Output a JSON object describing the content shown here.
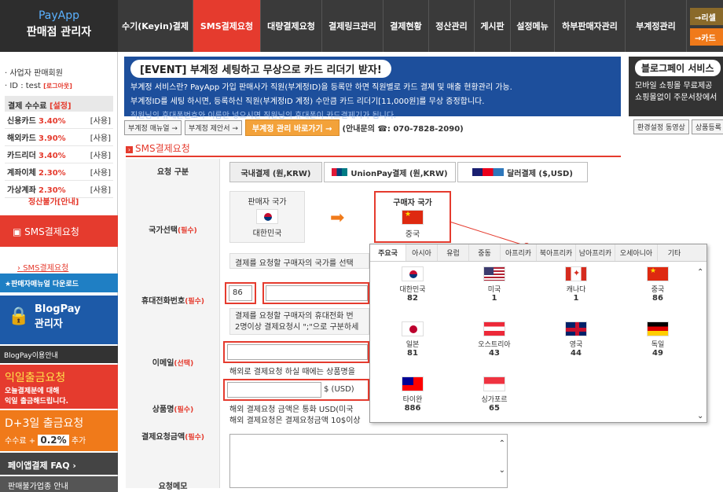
{
  "logo": {
    "brand": "PayApp",
    "subtitle": "판매점 관리자"
  },
  "nav": [
    "수기(Keyin)결제",
    "SMS결제요청",
    "대량결제요청",
    "결제링크관리",
    "결제현황",
    "정산관리",
    "게시판",
    "설정메뉴",
    "하부판매자관리",
    "부계정관리"
  ],
  "top_buttons": [
    "→리셀",
    "→카드"
  ],
  "sidebar": {
    "seller": "사업자 판매회원",
    "id_label": "ID",
    "id_value": ": test",
    "logout": "[로그아웃]",
    "fee_label": "결제 수수료",
    "fee_setting": "[설정]",
    "fees": [
      {
        "name": "신용카드",
        "rate": "3.40%",
        "tag": "[사용]"
      },
      {
        "name": "해외카드",
        "rate": "3.90%",
        "tag": "[사용]"
      },
      {
        "name": "카드리더",
        "rate": "3.40%",
        "tag": "[사용]"
      },
      {
        "name": "계좌이체",
        "rate": "2.30%",
        "tag": "[사용]"
      },
      {
        "name": "가상계좌",
        "rate": "2.30%",
        "tag": "[사용]"
      }
    ],
    "settle_notice": "정산불가[안내]",
    "menu_title": "SMS결제요청",
    "menu_sub": "SMS결제요청",
    "manual": "판매자매뉴얼 다운로드",
    "blogpay_title": "BlogPay",
    "blogpay_sub": "관리자",
    "blogpay_guide": "BlogPay이용안내",
    "promo1_title": "익일출금요청",
    "promo1_l1": "오늘결제분에 대해",
    "promo1_l2": "익일 출금해드립니다.",
    "promo2_title": "D+3일 출금요청",
    "promo2_l1": "수수료 +",
    "promo2_rate": "0.2%",
    "promo2_l2": "추가",
    "faq": "페이앱결제 FAQ",
    "more": "판매불가업종 안내"
  },
  "banner": {
    "title": "[EVENT] 부계정 세팅하고 무상으로 카드 리더기 받자!",
    "l1": "부계정 서비스란? PayApp 가입 판매사가 직원(부계정ID)을 등록만 하면 직원별로 카드 결제 및 매출 현황관리 가능.",
    "l2": "부계정ID를 세팅 하시면, 등록하신 직원(부계정ID 계정) 수만큼 카드 리더기[11,000원]를 무상 증정합니다.",
    "l3": "직원님의 휴대폰번호와 이름만 넣으시면 직원님의 휴대폰이 카드결제기가 됩니다."
  },
  "banner_buttons": {
    "b1": "부계정 매뉴얼 →",
    "b2": "부계정 제안서 →",
    "b3": "부계정 관리 바로가기 →",
    "contact": "(안내문의 ☎: 070-7828-2090)"
  },
  "blog": {
    "title": "블로그페이 서비스",
    "l1": "모바일 쇼핑몰 무료제공",
    "l2": "쇼핑몰없이 주문서창에서",
    "b1": "환경설정 동영상",
    "b2": "상품등록"
  },
  "section_title": "SMS결제요청",
  "labels": {
    "request_type": "요청 구분",
    "country": "국가선택",
    "phone": "휴대전화번호",
    "email": "이메일",
    "product": "상품명",
    "amount": "결제요청금액",
    "memo": "요청메모",
    "required": "(필수)",
    "optional": "(선택)"
  },
  "tabs": [
    "국내결제 (원,KRW)",
    "UnionPay결제 (원,KRW)",
    "달러결제 ($,USD)"
  ],
  "seller_country": {
    "label": "판매자 국가",
    "name": "대한민국"
  },
  "buyer_country": {
    "label": "구매자 국가",
    "name": "중국"
  },
  "help": {
    "country": "결제를 요청할 구매자의 국가를 선택",
    "phone1": "결제를 요청할 구매자의 휴대전화 번",
    "phone2": "2명이상 결제요청시 \";\"으로 구분하세",
    "email": "해외로 결제요청 하실 때에는 상품명을",
    "amount1": "해외 결제요청 금액은 통화 USD(미국",
    "amount2": "해외 결제요청은 결제요청금액 10$이상"
  },
  "phone_code": "86",
  "currency_unit": "$ (USD)",
  "popup": {
    "tabs": [
      "주요국",
      "아시아",
      "유럽",
      "중동",
      "아프리카",
      "북아프리카",
      "남아프리카",
      "오세아니아",
      "기타"
    ],
    "countries": [
      {
        "name": "대한민국",
        "code": "82",
        "flag": "kr"
      },
      {
        "name": "미국",
        "code": "1",
        "flag": "us"
      },
      {
        "name": "캐나다",
        "code": "1",
        "flag": "ca"
      },
      {
        "name": "중국",
        "code": "86",
        "flag": "cn"
      },
      {
        "name": "일본",
        "code": "81",
        "flag": "jp"
      },
      {
        "name": "오스트리아",
        "code": "43",
        "flag": "at"
      },
      {
        "name": "영국",
        "code": "44",
        "flag": "gb"
      },
      {
        "name": "독일",
        "code": "49",
        "flag": "de"
      },
      {
        "name": "타이완",
        "code": "886",
        "flag": "tw"
      },
      {
        "name": "싱가포르",
        "code": "65",
        "flag": "sg"
      }
    ]
  },
  "colors": {
    "accent": "#e53b2e",
    "nav_bg": "#3a3a3a",
    "banner_bg": "#1d4f9c"
  }
}
